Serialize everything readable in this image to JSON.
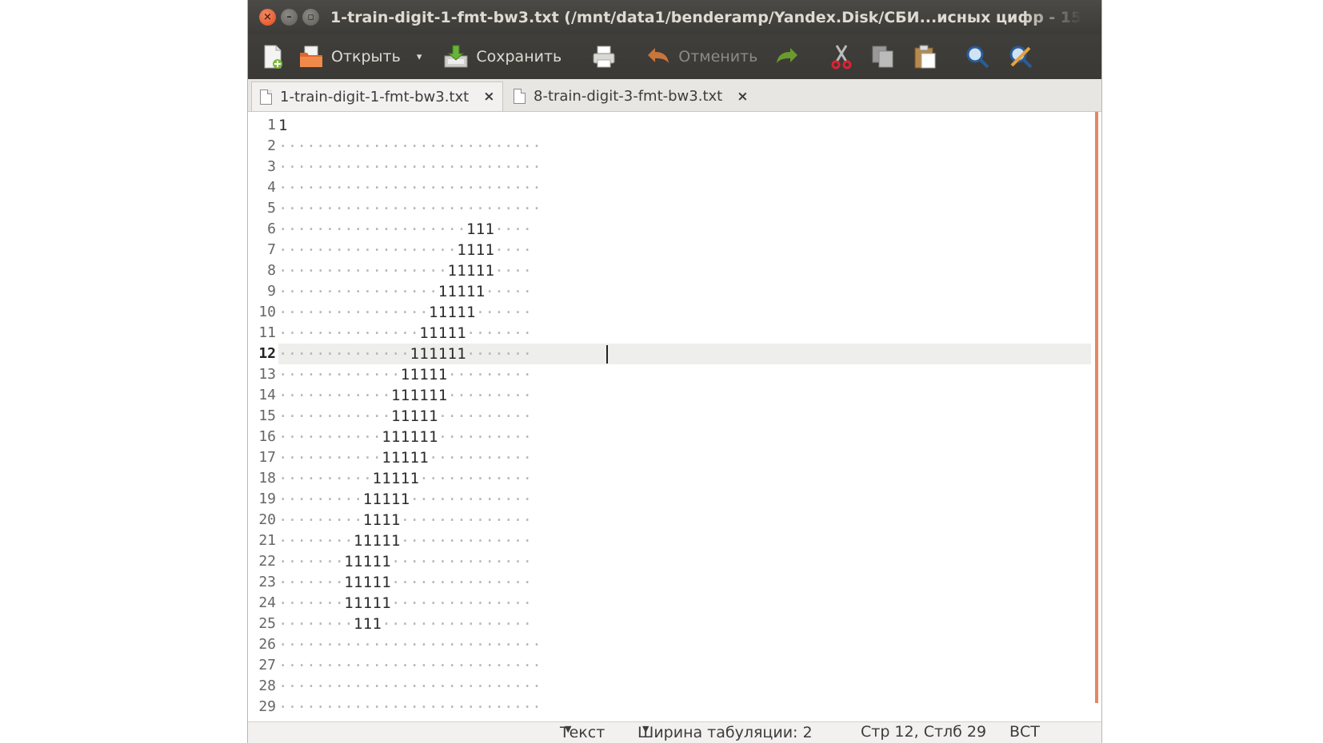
{
  "window": {
    "title": "1-train-digit-1-fmt-bw3.txt (/mnt/data1/benderamp/Yandex.Disk/СБИ...исных цифр - 15 фев"
  },
  "toolbar": {
    "new_icon": "new-document-icon",
    "open_label": "Открыть",
    "open_dropdown": "▾",
    "save_label": "Сохранить",
    "print_icon": "printer-icon",
    "undo_label": "Отменить",
    "redo_icon": "redo-icon",
    "cut_icon": "scissors-icon",
    "copy_icon": "copy-icon",
    "paste_icon": "clipboard-icon",
    "search_icon": "magnifier-icon",
    "replace_icon": "find-replace-icon"
  },
  "tabs": [
    {
      "label": "1-train-digit-1-fmt-bw3.txt",
      "close": "×",
      "active": true
    },
    {
      "label": "8-train-digit-3-fmt-bw3.txt",
      "close": "×",
      "active": false
    }
  ],
  "editor": {
    "current_line": 12,
    "lines": [
      {
        "n": "1",
        "text": "1"
      },
      {
        "n": "2",
        "text": "............................"
      },
      {
        "n": "3",
        "text": "............................"
      },
      {
        "n": "4",
        "text": "............................"
      },
      {
        "n": "5",
        "text": "............................"
      },
      {
        "n": "6",
        "text": "....................111...."
      },
      {
        "n": "7",
        "text": "...................1111...."
      },
      {
        "n": "8",
        "text": "..................11111...."
      },
      {
        "n": "9",
        "text": ".................11111....."
      },
      {
        "n": "10",
        "text": "................11111......"
      },
      {
        "n": "11",
        "text": "...............11111......."
      },
      {
        "n": "12",
        "text": "..............111111......."
      },
      {
        "n": "13",
        "text": ".............11111........."
      },
      {
        "n": "14",
        "text": "............111111........."
      },
      {
        "n": "15",
        "text": "............11111.........."
      },
      {
        "n": "16",
        "text": "...........111111.........."
      },
      {
        "n": "17",
        "text": "...........11111..........."
      },
      {
        "n": "18",
        "text": "..........11111............"
      },
      {
        "n": "19",
        "text": ".........11111............."
      },
      {
        "n": "20",
        "text": ".........1111.............."
      },
      {
        "n": "21",
        "text": "........11111.............."
      },
      {
        "n": "22",
        "text": ".......11111..............."
      },
      {
        "n": "23",
        "text": ".......11111..............."
      },
      {
        "n": "24",
        "text": ".......11111..............."
      },
      {
        "n": "25",
        "text": "........111................"
      },
      {
        "n": "26",
        "text": "............................"
      },
      {
        "n": "27",
        "text": "............................"
      },
      {
        "n": "28",
        "text": "............................"
      },
      {
        "n": "29",
        "text": "............................"
      }
    ]
  },
  "statusbar": {
    "syntax": "Текст",
    "tab_width": "Ширина табуляции: 2",
    "position": "Стр 12, Стлб 29",
    "mode": "ВСТ"
  },
  "colors": {
    "titlebar": "#3c3b37",
    "close_button": "#df4a16",
    "margin_line": "#e8865f",
    "current_line": "#eeeeec"
  }
}
